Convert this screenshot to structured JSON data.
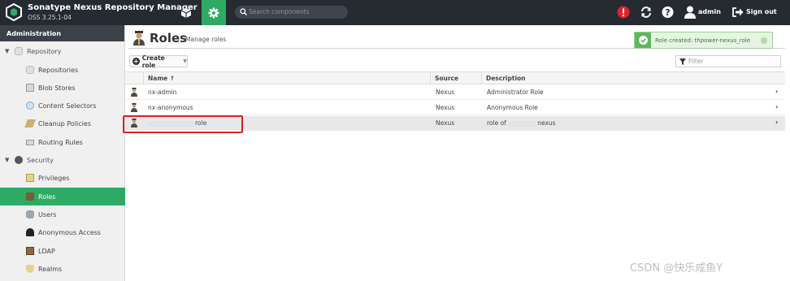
{
  "header": {
    "app_title": "Sonatype Nexus Repository Manager",
    "version": "OSS 3.25.1-04",
    "search_placeholder": "Search components",
    "user_label": "admin",
    "signout_label": "Sign out"
  },
  "sidebar": {
    "header": "Administration",
    "items": [
      {
        "label": "Repository"
      },
      {
        "label": "Repositories"
      },
      {
        "label": "Blob Stores"
      },
      {
        "label": "Content Selectors"
      },
      {
        "label": "Cleanup Policies"
      },
      {
        "label": "Routing Rules"
      },
      {
        "label": "Security"
      },
      {
        "label": "Privileges"
      },
      {
        "label": "Roles"
      },
      {
        "label": "Users"
      },
      {
        "label": "Anonymous Access"
      },
      {
        "label": "LDAP"
      },
      {
        "label": "Realms"
      }
    ]
  },
  "main": {
    "title": "Roles",
    "subtitle": "Manage roles",
    "create_label": "Create role",
    "filter_placeholder": "Filter",
    "toast_text": "Role created: thpower-nexus_role",
    "columns": [
      "Name ↑",
      "Source",
      "Description"
    ],
    "rows": [
      {
        "name": "nx-admin",
        "source": "Nexus",
        "description": "Administrator Role"
      },
      {
        "name": "nx-anonymous",
        "source": "Nexus",
        "description": "Anonymous Role"
      },
      {
        "name": "role",
        "source": "Nexus",
        "description_prefix": "role of",
        "description_suffix": "nexus"
      }
    ]
  },
  "watermark": "CSDN @快乐咸鱼Y",
  "colors": {
    "accent": "#2dab65",
    "topbar": "#252b31",
    "alert": "#d9262c",
    "highlight": "#e02020"
  }
}
